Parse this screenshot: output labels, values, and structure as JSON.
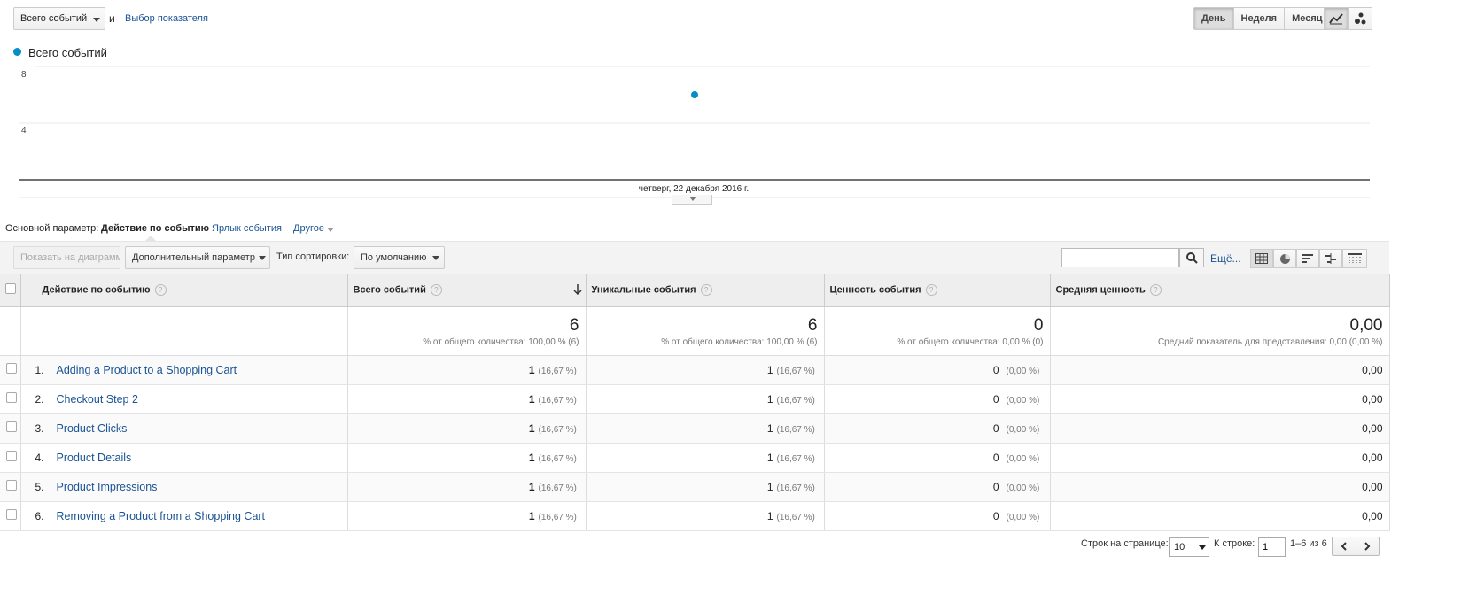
{
  "controls": {
    "metric_select": "Всего событий",
    "conj": "и",
    "choose_metric": "Выбор показателя",
    "periods": [
      "День",
      "Неделя",
      "Месяц"
    ],
    "active_period": "День"
  },
  "chart_data": {
    "type": "scatter",
    "series": [
      {
        "name": "Всего событий",
        "color": "#058dc7",
        "values": [
          6
        ]
      }
    ],
    "categories": [
      "четверг, 22 декабря 2016 г."
    ],
    "y_ticks": [
      "8",
      "4"
    ],
    "ylim": [
      0,
      8
    ],
    "grid": true
  },
  "dimensions": {
    "label": "Основной параметр:",
    "active": "Действие по событию",
    "other1": "Ярлык события",
    "other2": "Другое"
  },
  "toolbar": {
    "plot_rows": "Показать на диаграмме",
    "secondary_dim": "Дополнительный параметр",
    "sort_label": "Тип сортировки:",
    "sort_value": "По умолчанию",
    "search_placeholder": "",
    "more": "Ещё..."
  },
  "table": {
    "headers": [
      "Действие по событию",
      "Всего событий",
      "Уникальные события",
      "Ценность события",
      "Средняя ценность"
    ],
    "totals": {
      "total_events": "6",
      "total_events_sub": "% от общего количества: 100,00 % (6)",
      "unique_events": "6",
      "unique_events_sub": "% от общего количества: 100,00 % (6)",
      "event_value": "0",
      "event_value_sub": "% от общего количества: 0,00 % (0)",
      "avg_value": "0,00",
      "avg_value_sub": "Средний показатель для представления: 0,00 (0,00 %)"
    },
    "rows": [
      {
        "idx": "1.",
        "name": "Adding a Product to a Shopping Cart",
        "total": "1",
        "total_pct": "(16,67 %)",
        "unique": "1",
        "unique_pct": "(16,67 %)",
        "value": "0",
        "value_pct": "(0,00 %)",
        "avg": "0,00"
      },
      {
        "idx": "2.",
        "name": "Checkout Step 2",
        "total": "1",
        "total_pct": "(16,67 %)",
        "unique": "1",
        "unique_pct": "(16,67 %)",
        "value": "0",
        "value_pct": "(0,00 %)",
        "avg": "0,00"
      },
      {
        "idx": "3.",
        "name": "Product Clicks",
        "total": "1",
        "total_pct": "(16,67 %)",
        "unique": "1",
        "unique_pct": "(16,67 %)",
        "value": "0",
        "value_pct": "(0,00 %)",
        "avg": "0,00"
      },
      {
        "idx": "4.",
        "name": "Product Details",
        "total": "1",
        "total_pct": "(16,67 %)",
        "unique": "1",
        "unique_pct": "(16,67 %)",
        "value": "0",
        "value_pct": "(0,00 %)",
        "avg": "0,00"
      },
      {
        "idx": "5.",
        "name": "Product Impressions",
        "total": "1",
        "total_pct": "(16,67 %)",
        "unique": "1",
        "unique_pct": "(16,67 %)",
        "value": "0",
        "value_pct": "(0,00 %)",
        "avg": "0,00"
      },
      {
        "idx": "6.",
        "name": "Removing a Product from a Shopping Cart",
        "total": "1",
        "total_pct": "(16,67 %)",
        "unique": "1",
        "unique_pct": "(16,67 %)",
        "value": "0",
        "value_pct": "(0,00 %)",
        "avg": "0,00"
      }
    ]
  },
  "footer": {
    "rows_per_page_label": "Строк на странице:",
    "rows_per_page": "10",
    "goto_label": "К строке:",
    "goto_value": "1",
    "range": "1–6 из 6"
  }
}
